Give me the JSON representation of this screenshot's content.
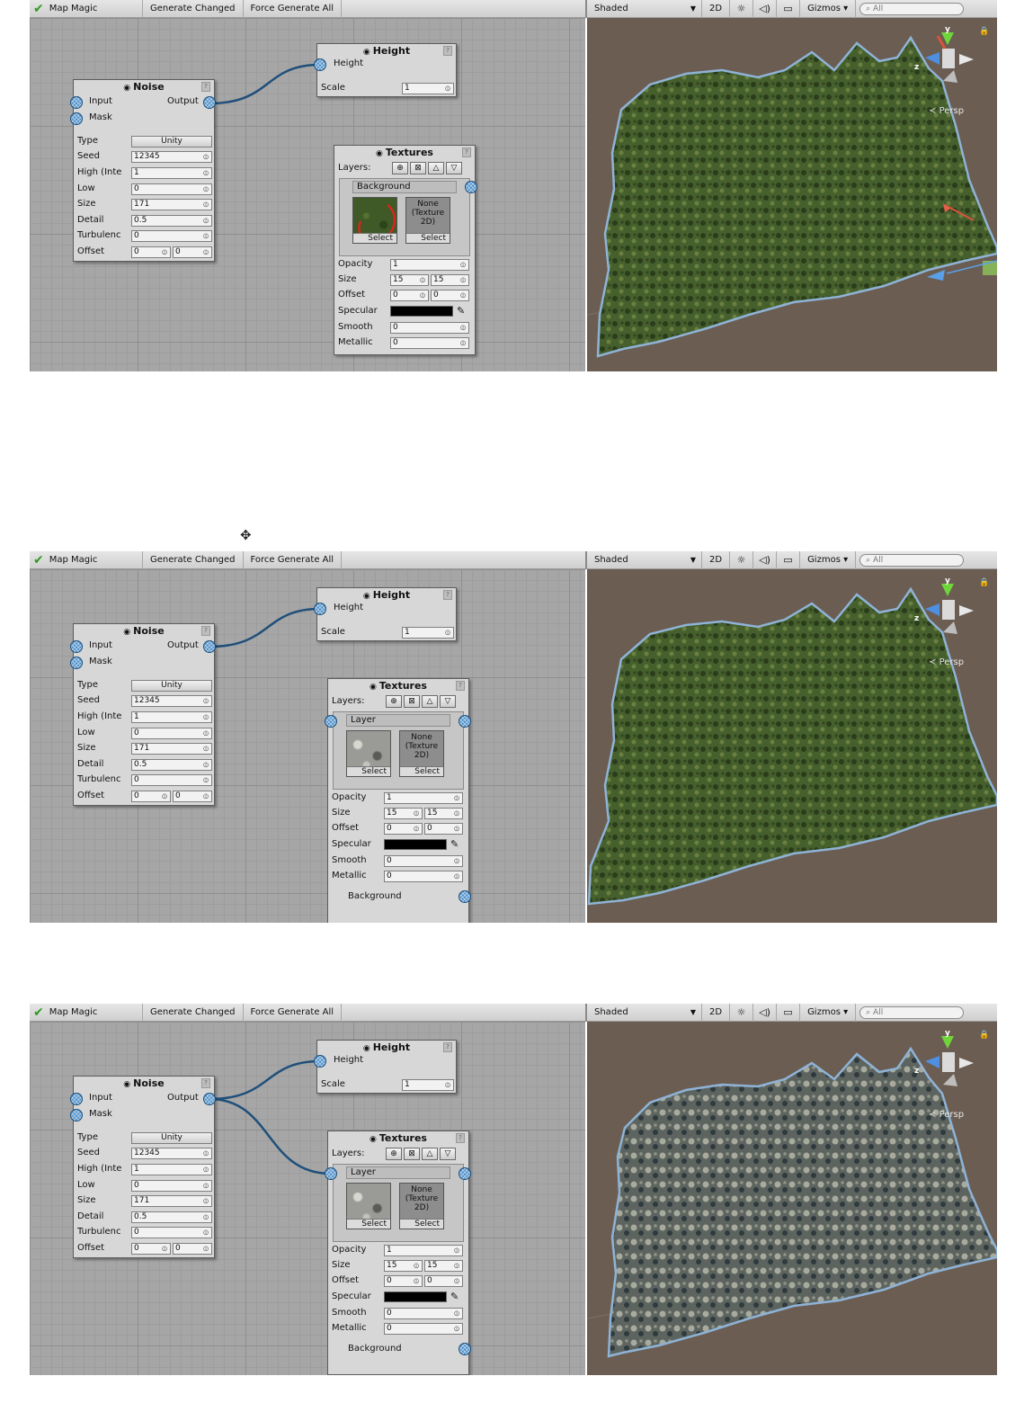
{
  "toolbar": {
    "app_title": "Map Magic",
    "generate_changed": "Generate Changed",
    "force_generate_all": "Force Generate All",
    "shade_mode": "Shaded",
    "mode_2d": "2D",
    "gizmos": "Gizmos",
    "search_placeholder": "All",
    "check_icon": "check-icon"
  },
  "scene": {
    "persp_label": "Persp",
    "axis_y": "y",
    "axis_z": "z"
  },
  "noise_node": {
    "title": "Noise",
    "input": "Input",
    "output": "Output",
    "mask": "Mask",
    "fields": [
      {
        "label": "Type",
        "value": "Unity"
      },
      {
        "label": "Seed",
        "value": "12345"
      },
      {
        "label": "High (Inte",
        "value": "1"
      },
      {
        "label": "Low",
        "value": "0"
      },
      {
        "label": "Size",
        "value": "171"
      },
      {
        "label": "Detail",
        "value": "0.5"
      },
      {
        "label": "Turbulenc",
        "value": "0"
      },
      {
        "label": "Offset",
        "value_x": "0",
        "value_y": "0"
      }
    ]
  },
  "height_node": {
    "title": "Height",
    "input": "Height",
    "scale_label": "Scale",
    "scale_value": "1"
  },
  "textures_node": {
    "title": "Textures",
    "layers_label": "Layers:",
    "layer_name_1": "Background",
    "layer_name_2": "Layer",
    "none_texture": "None (Texture 2D)",
    "select": "Select",
    "bottom_layer": "Background",
    "fields": {
      "opacity_label": "Opacity",
      "opacity": "1",
      "size_label": "Size",
      "size_x": "15",
      "size_y": "15",
      "offset_label": "Offset",
      "offset_x": "0",
      "offset_y": "0",
      "specular_label": "Specular",
      "specular_color": "#000000",
      "smooth_label": "Smooth",
      "smooth": "0",
      "metallic_label": "Metallic",
      "metallic": "0"
    }
  },
  "colors": {
    "graph_bg": "#a6a6a6",
    "scene_bg": "#6b5d52",
    "port": "#4d8fc9",
    "wire": "#1f4f7a",
    "terrain_green": "#3f5a2a",
    "terrain_rock": "#6f7266",
    "terrain_outline": "#8fb3d6"
  }
}
